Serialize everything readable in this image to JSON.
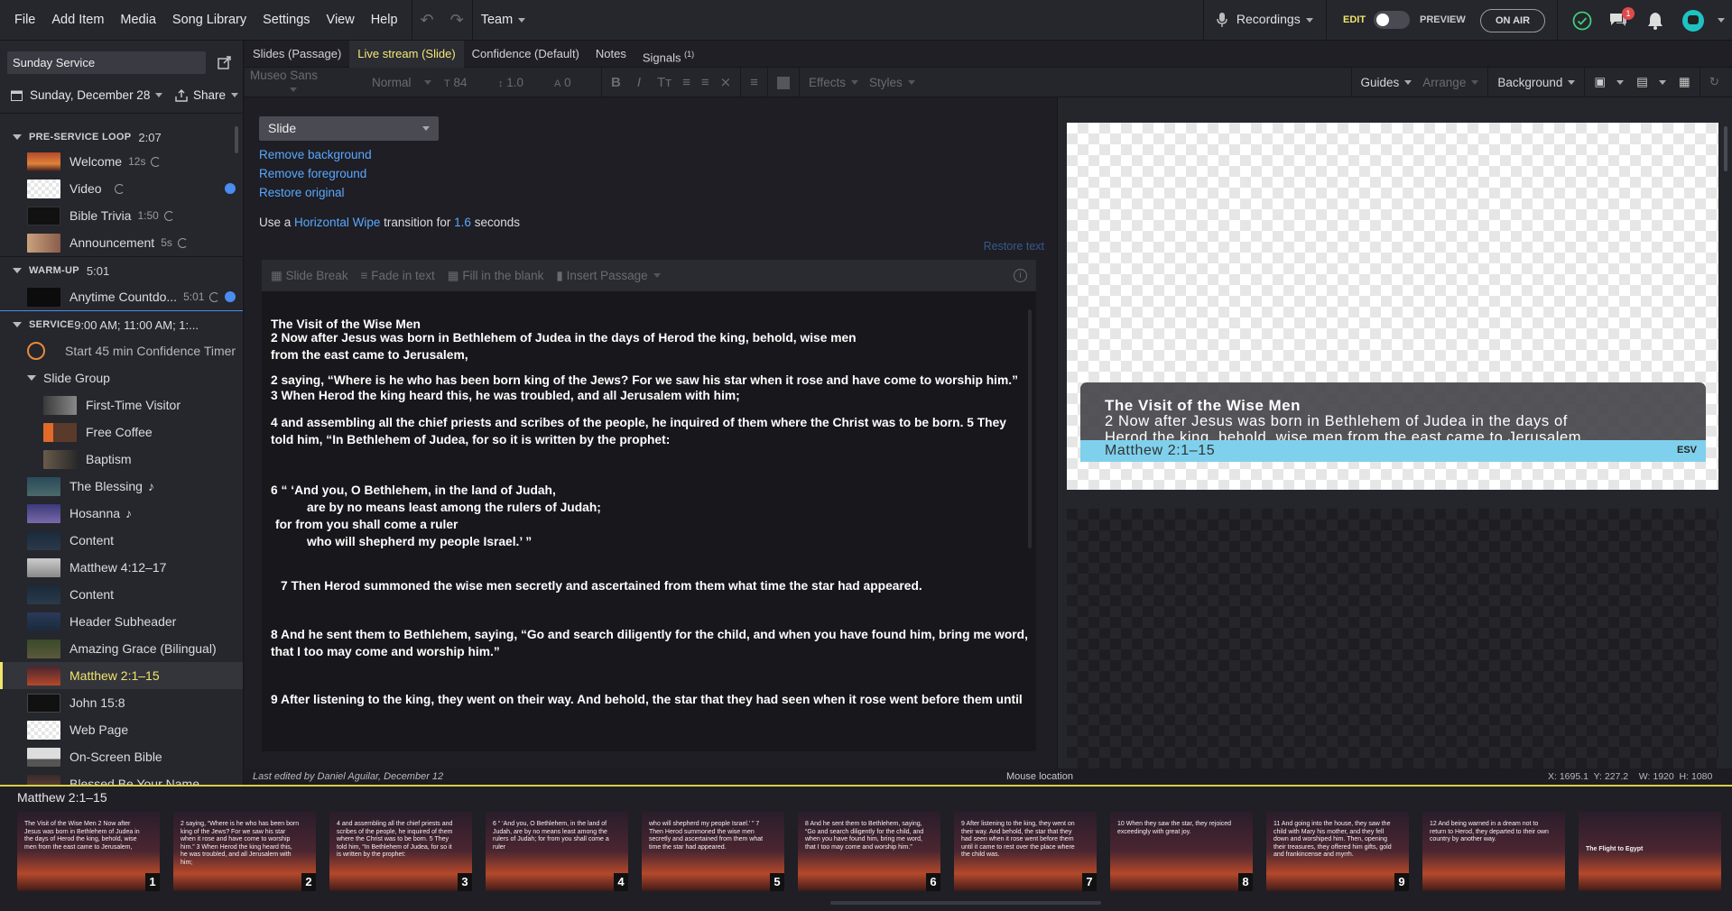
{
  "menu": {
    "items": [
      "File",
      "Add Item",
      "Media",
      "Song Library",
      "Settings",
      "View",
      "Help"
    ],
    "team": "Team",
    "recordings": "Recordings",
    "edit": "EDIT",
    "preview": "PREVIEW",
    "on_air": "ON AIR",
    "chat_badge": "1"
  },
  "sidebar": {
    "plan_name": "Sunday Service",
    "date": "Sunday, December 28",
    "share": "Share",
    "sections": [
      {
        "title": "PRE-SERVICE LOOP",
        "duration": "2:07"
      },
      {
        "title": "WARM-UP",
        "duration": "5:01"
      },
      {
        "title": "SERVICE",
        "times": "9:00 AM; 11:00 AM; 1:..."
      }
    ],
    "items": [
      {
        "label": "Welcome",
        "duration": "12s"
      },
      {
        "label": "Video",
        "duration": ""
      },
      {
        "label": "Bible Trivia",
        "duration": "1:50"
      },
      {
        "label": "Announcement",
        "duration": "5s"
      },
      {
        "label": "Anytime Countdo...",
        "duration": "5:01"
      },
      {
        "label": "Start 45 min Confidence Timer"
      },
      {
        "label": "Slide Group"
      },
      {
        "label": "First-Time Visitor"
      },
      {
        "label": "Free Coffee"
      },
      {
        "label": "Baptism"
      },
      {
        "label": "The Blessing"
      },
      {
        "label": "Hosanna"
      },
      {
        "label": "Content"
      },
      {
        "label": "Matthew 4:12–17"
      },
      {
        "label": "Content"
      },
      {
        "label": "Header Subheader"
      },
      {
        "label": "Amazing Grace (Bilingual)"
      },
      {
        "label": "Matthew 2:1–15"
      },
      {
        "label": "John 15:8"
      },
      {
        "label": "Web Page"
      },
      {
        "label": "On-Screen Bible"
      },
      {
        "label": "Blessed Be Your Name"
      }
    ]
  },
  "tabs": [
    {
      "label": "Slides (Passage)"
    },
    {
      "label": "Live stream (Slide)"
    },
    {
      "label": "Confidence (Default)"
    },
    {
      "label": "Notes"
    },
    {
      "label": "Signals"
    }
  ],
  "signals_count": "(1)",
  "toolbar": {
    "font": "Museo Sans",
    "weight": "Normal",
    "size": "84",
    "line": "1.0",
    "spacing": "0",
    "effects": "Effects",
    "styles": "Styles",
    "guides": "Guides",
    "arrange": "Arrange",
    "background": "Background"
  },
  "editor": {
    "layout_select": "Slide",
    "remove_background": "Remove background",
    "remove_foreground": "Remove foreground",
    "restore_original": "Restore original",
    "transition_pre": "Use a",
    "transition_name": "Horizontal Wipe",
    "transition_mid": "transition for",
    "transition_secs": "1.6",
    "transition_post": "seconds",
    "restore_text": "Restore text",
    "slide_break": "Slide Break",
    "fade_in": "Fade in text",
    "fill_blank": "Fill in the blank",
    "insert_passage": "Insert Passage",
    "heading": "The Visit of the Wise Men",
    "v2": "2 Now after Jesus was born in Bethlehem of Judea in the days of Herod the king, behold, wise men from the east came to Jerusalem,",
    "v2b": "2 saying, “Where is he who has been born king of the Jews? For we saw his star when it rose and have come to worship him.”",
    "v3": "3 When Herod the king heard this, he was troubled, and all Jerusalem with him;",
    "v4": "4 and assembling all the chief priests and scribes of the people, he inquired of them where the Christ was to be born. 5 They told him, “In Bethlehem of Judea, for so it is written by the prophet:",
    "v6a": "6 “ ‘And you, O Bethlehem, in the land of Judah,",
    "v6b": "are by no means least among the rulers of Judah;",
    "v6c": "for from you shall come a ruler",
    "v6d": "who will shepherd my people Israel.’ ”",
    "v7": "7 Then Herod summoned the wise men secretly and ascertained from them what time the star had appeared.",
    "v8": "8 And he sent them to Bethlehem, saying, “Go and search diligently for the child, and when you have found him, bring me word, that I too may come and worship him.”",
    "v9": "9 After listening to the king, they went on their way. And behold, the star that they had seen when it rose went before them until"
  },
  "preview": {
    "title": "The Visit of the Wise Men",
    "line1": "2 Now after Jesus was born in Bethlehem of Judea in the days of",
    "line2": "Herod the king, behold, wise men from the east came to Jerusalem,",
    "reference": "Matthew 2:1–15",
    "version": "ESV"
  },
  "status": {
    "last_edited": "Last edited by Daniel Aguilar, December 12",
    "mouse": "Mouse location",
    "coords": "X: 1695.1  Y: 227.2    W: 1920  H: 1080"
  },
  "filmstrip": {
    "title": "Matthew 2:1–15",
    "slides": [
      {
        "num": "1",
        "text": "The Visit of the Wise Men 2 Now after Jesus was born in Bethlehem of Judea in the days of Herod the king, behold, wise men from the east came to Jerusalem,"
      },
      {
        "num": "2",
        "text": "2 saying, “Where is he who has been born king of the Jews? For we saw his star when it rose and have come to worship him.” 3 When Herod the king heard this, he was troubled, and all Jerusalem with him;"
      },
      {
        "num": "3",
        "text": "4 and assembling all the chief priests and scribes of the people, he inquired of them where the Christ was to be born. 5 They told him, “In Bethlehem of Judea, for so it is written by the prophet:"
      },
      {
        "num": "4",
        "text": "6 “ ‘And you, O Bethlehem, in the land of Judah, are by no means least among the rulers of Judah; for from you shall come a ruler"
      },
      {
        "num": "5",
        "text": "who will shepherd my people Israel.’ ” 7 Then Herod summoned the wise men secretly and ascertained from them what time the star had appeared."
      },
      {
        "num": "6",
        "text": "8 And he sent them to Bethlehem, saying, “Go and search diligently for the child, and when you have found him, bring me word, that I too may come and worship him.”"
      },
      {
        "num": "7",
        "text": "9 After listening to the king, they went on their way. And behold, the star that they had seen when it rose went before them until it came to rest over the place where the child was."
      },
      {
        "num": "8",
        "text": "10 When they saw the star, they rejoiced exceedingly with great joy."
      },
      {
        "num": "9",
        "text": "11 And going into the house, they saw the child with Mary his mother, and they fell down and worshiped him. Then, opening their treasures, they offered him gifts, gold and frankincense and myrrh."
      },
      {
        "num": "",
        "text": "12 And being warned in a dream not to return to Herod, they departed to their own country by another way."
      },
      {
        "num": "",
        "text": "The Flight to Egypt"
      }
    ]
  }
}
